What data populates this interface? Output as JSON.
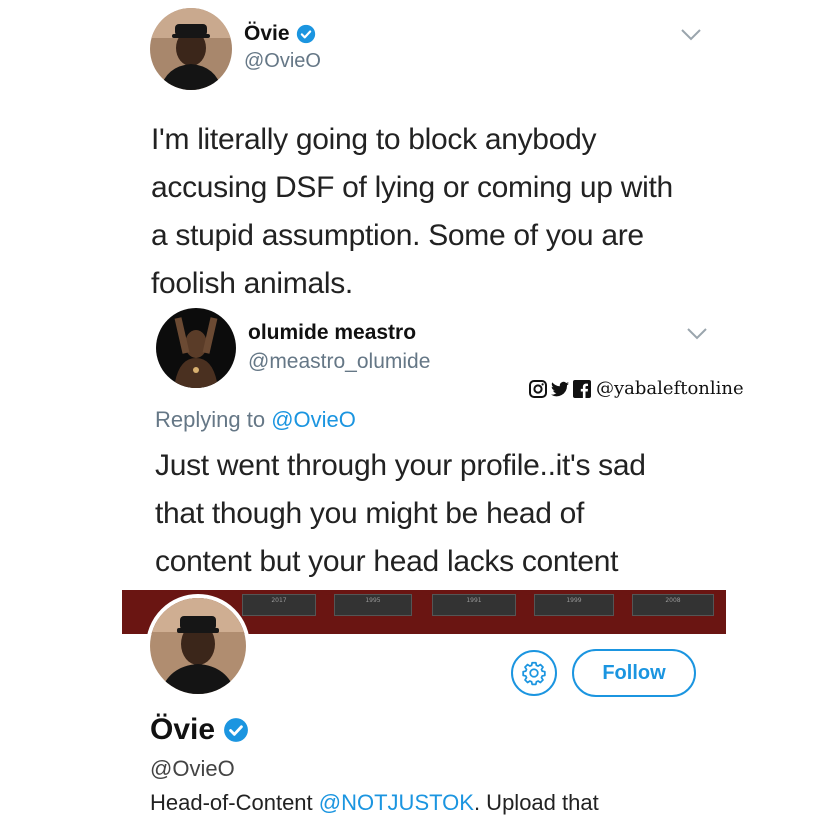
{
  "tweet1": {
    "display_name": "Övie",
    "handle": "@OvieO",
    "text_lines": [
      "I'm literally going to block anybody",
      "accusing DSF of lying or coming up with",
      "a stupid assumption. Some of you are",
      "foolish animals."
    ]
  },
  "tweet2": {
    "display_name": "olumide meastro",
    "handle": "@meastro_olumide",
    "replying_label": "Replying to",
    "replying_handle": "@OvieO",
    "text_lines": [
      "Just went through your profile..it's sad",
      "that though you might be head of",
      "content but your head lacks content"
    ]
  },
  "watermark": {
    "text": "@yabaleftonline",
    "icons": [
      "instagram-icon",
      "twitter-icon",
      "facebook-icon"
    ]
  },
  "profile": {
    "banner_labels": [
      "2017",
      "1995",
      "1991",
      "1999",
      "2008"
    ],
    "follow_label": "Follow",
    "display_name": "Övie",
    "handle": "@OvieO",
    "bio_prefix": "Head-of-Content",
    "bio_mention": "@NOTJUSTOK",
    "bio_suffix": ". Upload that"
  },
  "colors": {
    "link": "#1b95e0",
    "handle_gray": "#657786",
    "banner": "#6a1512"
  }
}
